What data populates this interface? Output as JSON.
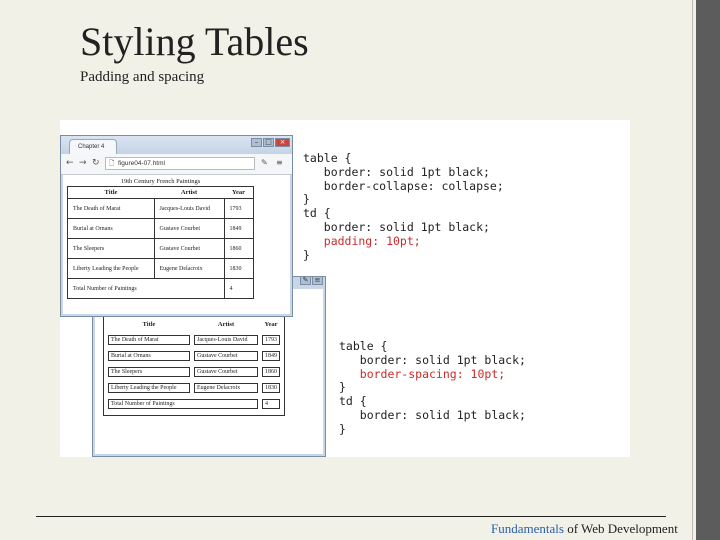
{
  "slide": {
    "title": "Styling Tables",
    "subtitle": "Padding and spacing",
    "footer_accent": "Fundamentals",
    "footer_rest": " of Web Development"
  },
  "browser": {
    "tab_title": "Chapter 4",
    "url": "figure04-07.html"
  },
  "table": {
    "caption": "19th Century French Paintings",
    "headers": [
      "Title",
      "Artist",
      "Year"
    ],
    "rows": [
      [
        "The Death of Marat",
        "Jacques-Louis David",
        "1793"
      ],
      [
        "Burial at Ornans",
        "Gustave Courbet",
        "1849"
      ],
      [
        "The Sleepers",
        "Gustave Courbet",
        "1860"
      ],
      [
        "Liberty Leading the People",
        "Eugene Delacroix",
        "1830"
      ]
    ],
    "total_label": "Total Number of Paintings",
    "total_value": "4"
  },
  "code1": {
    "l1": "table {",
    "l2": "   border: solid 1pt black;",
    "l3": "   border-collapse: collapse;",
    "l4": "}",
    "l5": "td {",
    "l6": "   border: solid 1pt black;",
    "l7": "   padding: 10pt;",
    "l8": "}"
  },
  "code2": {
    "l1": "table {",
    "l2": "   border: solid 1pt black;",
    "l3": "   border-spacing: 10pt;",
    "l4": "}",
    "l5": "td {",
    "l6": "   border: solid 1pt black;",
    "l7": "}"
  },
  "colors": {
    "background": "#f2f1e8",
    "accent_link": "#2a5ea8",
    "code_highlight": "#cc2b2b"
  }
}
